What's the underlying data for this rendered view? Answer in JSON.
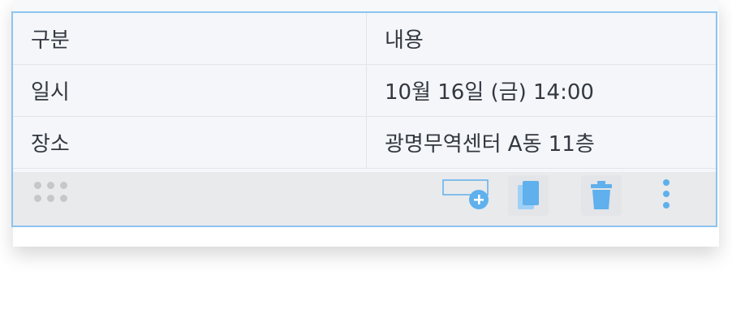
{
  "table": {
    "rows": [
      {
        "label": "구분",
        "value": "내용"
      },
      {
        "label": "일시",
        "value": "10월 16일 (금) 14:00"
      },
      {
        "label": "장소",
        "value": "광명무역센터 A동 11층"
      }
    ]
  },
  "toolbar": {
    "icons": [
      "drag-handle-icon",
      "add-row-icon",
      "duplicate-icon",
      "trash-icon",
      "more-vertical-icon"
    ]
  },
  "colors": {
    "accent": "#8cc4ef",
    "icon_blue": "#5fb0ec",
    "table_bg": "#f4f6f9",
    "toolbar_bg": "#e9eaec"
  }
}
